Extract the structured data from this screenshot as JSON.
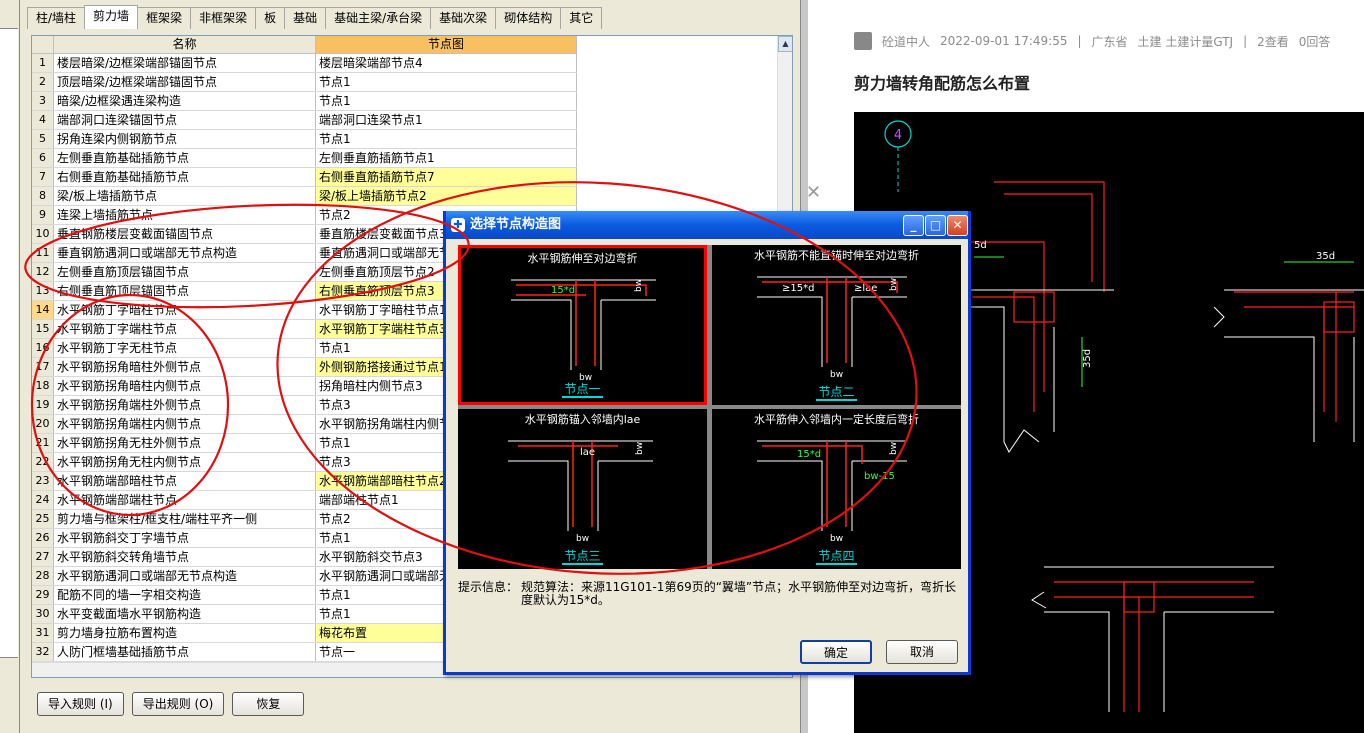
{
  "tabs": [
    "柱/墙柱",
    "剪力墙",
    "框架梁",
    "非框架梁",
    "板",
    "基础",
    "基础主梁/承台梁",
    "基础次梁",
    "砌体结构",
    "其它"
  ],
  "active_tab": 1,
  "table": {
    "headers": {
      "name": "名称",
      "node": "节点图"
    },
    "rows": [
      {
        "num": "1",
        "name": "楼层暗梁/边框梁端部锚固节点",
        "node": "楼层暗梁端部节点4",
        "yellow": false
      },
      {
        "num": "2",
        "name": "顶层暗梁/边框梁端部锚固节点",
        "node": "节点1",
        "yellow": false
      },
      {
        "num": "3",
        "name": "暗梁/边框梁遇连梁构造",
        "node": "节点1",
        "yellow": false
      },
      {
        "num": "4",
        "name": "端部洞口连梁锚固节点",
        "node": "端部洞口连梁节点1",
        "yellow": false
      },
      {
        "num": "5",
        "name": "拐角连梁内侧钢筋节点",
        "node": "节点1",
        "yellow": false
      },
      {
        "num": "6",
        "name": "左侧垂直筋基础插筋节点",
        "node": "左侧垂直筋插筋节点1",
        "yellow": false
      },
      {
        "num": "7",
        "name": "右侧垂直筋基础插筋节点",
        "node": "右侧垂直筋插筋节点7",
        "yellow": true
      },
      {
        "num": "8",
        "name": "梁/板上墙插筋节点",
        "node": "梁/板上墙插筋节点2",
        "yellow": true
      },
      {
        "num": "9",
        "name": "连梁上墙插筋节点",
        "node": "节点2",
        "yellow": false
      },
      {
        "num": "10",
        "name": "垂直钢筋楼层变截面锚固节点",
        "node": "垂直筋楼层变截面节点3",
        "yellow": false
      },
      {
        "num": "11",
        "name": "垂直钢筋遇洞口或端部无节点构造",
        "node": "垂直筋遇洞口或端部无节点",
        "yellow": false
      },
      {
        "num": "12",
        "name": "左侧垂直筋顶层锚固节点",
        "node": "左侧垂直筋顶层节点2",
        "yellow": false
      },
      {
        "num": "13",
        "name": "右侧垂直筋顶层锚固节点",
        "node": "右侧垂直筋顶层节点3",
        "yellow": true
      },
      {
        "num": "14",
        "name": "水平钢筋丁字暗柱节点",
        "node": "水平钢筋丁字暗柱节点1",
        "yellow": false,
        "selected": true
      },
      {
        "num": "15",
        "name": "水平钢筋丁字端柱节点",
        "node": "水平钢筋丁字端柱节点3",
        "yellow": true
      },
      {
        "num": "16",
        "name": "水平钢筋丁字无柱节点",
        "node": "节点1",
        "yellow": false
      },
      {
        "num": "17",
        "name": "水平钢筋拐角暗柱外侧节点",
        "node": "外侧钢筋搭接通过节点1",
        "yellow": true
      },
      {
        "num": "18",
        "name": "水平钢筋拐角暗柱内侧节点",
        "node": "拐角暗柱内侧节点3",
        "yellow": false
      },
      {
        "num": "19",
        "name": "水平钢筋拐角端柱外侧节点",
        "node": "节点3",
        "yellow": false
      },
      {
        "num": "20",
        "name": "水平钢筋拐角端柱内侧节点",
        "node": "水平钢筋拐角端柱内侧节点",
        "yellow": false
      },
      {
        "num": "21",
        "name": "水平钢筋拐角无柱外侧节点",
        "node": "节点1",
        "yellow": false
      },
      {
        "num": "22",
        "name": "水平钢筋拐角无柱内侧节点",
        "node": "节点3",
        "yellow": false
      },
      {
        "num": "23",
        "name": "水平钢筋端部暗柱节点",
        "node": "水平钢筋端部暗柱节点2",
        "yellow": true
      },
      {
        "num": "24",
        "name": "水平钢筋端部端柱节点",
        "node": "端部端柱节点1",
        "yellow": false
      },
      {
        "num": "25",
        "name": "剪力墙与框架柱/框支柱/端柱平齐一侧",
        "node": "节点2",
        "yellow": false
      },
      {
        "num": "26",
        "name": "水平钢筋斜交丁字墙节点",
        "node": "节点1",
        "yellow": false
      },
      {
        "num": "27",
        "name": "水平钢筋斜交转角墙节点",
        "node": "水平钢筋斜交节点3",
        "yellow": false
      },
      {
        "num": "28",
        "name": "水平钢筋遇洞口或端部无节点构造",
        "node": "水平钢筋遇洞口或端部无",
        "yellow": false
      },
      {
        "num": "29",
        "name": "配筋不同的墙一字相交构造",
        "node": "节点1",
        "yellow": false
      },
      {
        "num": "30",
        "name": "水平变截面墙水平钢筋构造",
        "node": "节点1",
        "yellow": false
      },
      {
        "num": "31",
        "name": "剪力墙身拉筋布置构造",
        "node": "梅花布置",
        "yellow": true
      },
      {
        "num": "32",
        "name": "人防门框墙基础插筋节点",
        "node": "节点一",
        "yellow": false
      },
      {
        "num": "33",
        "name": "人防门框墙顶部节点",
        "node": "节点二",
        "yellow": false
      }
    ]
  },
  "bottom_buttons": {
    "import": "导入规则 (I)",
    "export": "导出规则 (O)",
    "restore": "恢复"
  },
  "dialog": {
    "title": "选择节点构造图",
    "panels": [
      {
        "title": "水平钢筋伸至对边弯折",
        "label": "节点一",
        "dims": [
          "15*d",
          "bw",
          "bw"
        ],
        "selected": true
      },
      {
        "title": "水平钢筋不能直锚时伸至对边弯折",
        "label": "节点二",
        "dims": [
          "≥15*d",
          "≥lae",
          "bw",
          "bw"
        ],
        "selected": false
      },
      {
        "title": "水平钢筋锚入邻墙内lae",
        "label": "节点三",
        "dims": [
          "lae",
          "bw",
          "bw"
        ],
        "selected": false
      },
      {
        "title": "水平筋伸入邻墙内一定长度后弯折",
        "label": "节点四",
        "dims": [
          "15*d",
          "bw-15",
          "bw",
          "bw"
        ],
        "selected": false
      }
    ],
    "hint_label": "提示信息：",
    "hint_text": "规范算法：来源11G101-1第69页的“翼墙”节点；水平钢筋伸至对边弯折，弯折长度默认为15*d。",
    "ok": "确定",
    "cancel": "取消"
  },
  "article": {
    "author": "砼道中人",
    "datetime": "2022-09-01 17:49:55",
    "location": "广东省",
    "tags": "土建 土建计量GTJ",
    "views": "2查看",
    "answers": "0回答",
    "title": "剪力墙转角配筋怎么布置",
    "cad_labels": {
      "axis": "4",
      "d1": "5d",
      "d2": "35d",
      "d3": "35d"
    }
  },
  "colors": {
    "annotation": "#e01010",
    "cad_red": "#ff2020",
    "cad_white": "#ffffff",
    "cad_cyan": "#00d8d8",
    "cad_green": "#30ff30",
    "title_bar": "#0a5ae0"
  }
}
